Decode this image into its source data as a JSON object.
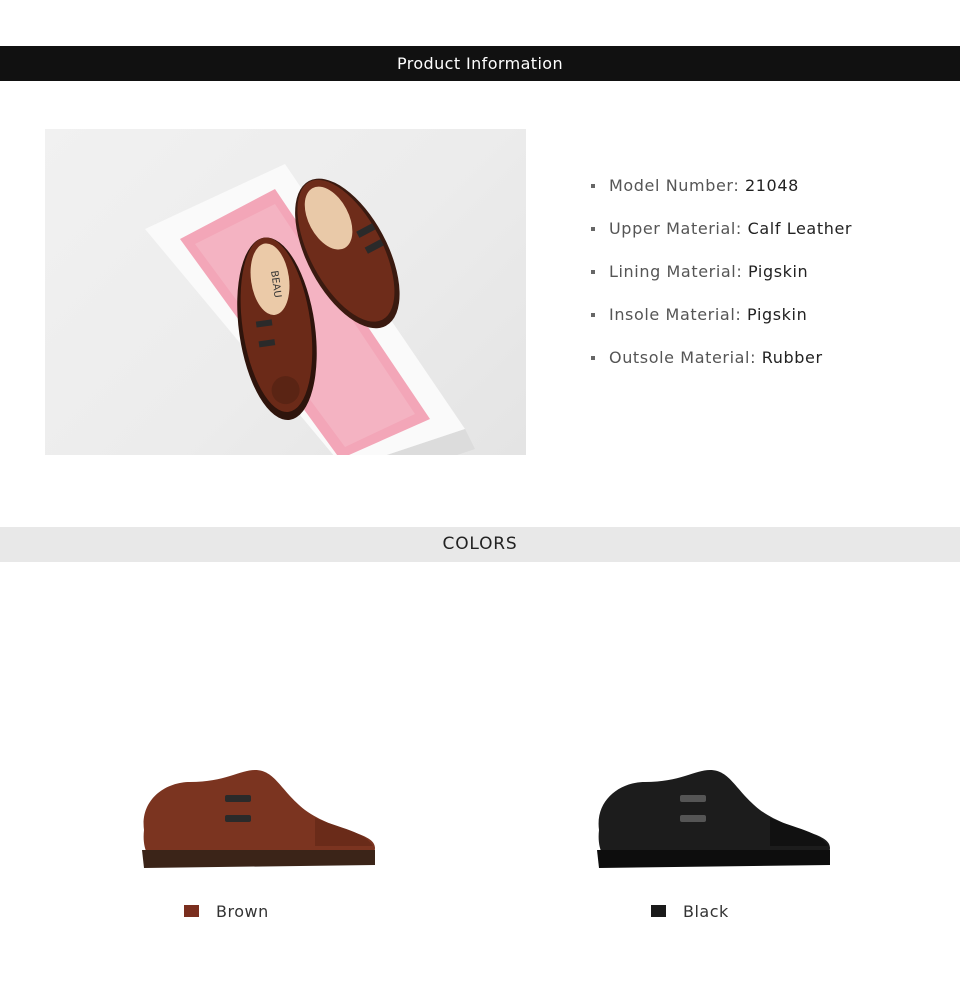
{
  "header": {
    "title": "Product Information"
  },
  "hero": {
    "icon": "product-photo-brand",
    "brand_text": "BEAU"
  },
  "specs": [
    {
      "label": "Model Number:",
      "value": "21048"
    },
    {
      "label": "Upper Material:",
      "value": "Calf Leather"
    },
    {
      "label": "Lining Material:",
      "value": "Pigskin"
    },
    {
      "label": "Insole Material:",
      "value": "Pigskin"
    },
    {
      "label": "Outsole Material:",
      "value": "Rubber"
    }
  ],
  "colors_section": {
    "title": "COLORS"
  },
  "colors": [
    {
      "name": "Brown",
      "hex": "#7a2e1e",
      "shoe_color": "#7b3420"
    },
    {
      "name": "Black",
      "hex": "#1a1a1a",
      "shoe_color": "#1c1c1c"
    }
  ]
}
